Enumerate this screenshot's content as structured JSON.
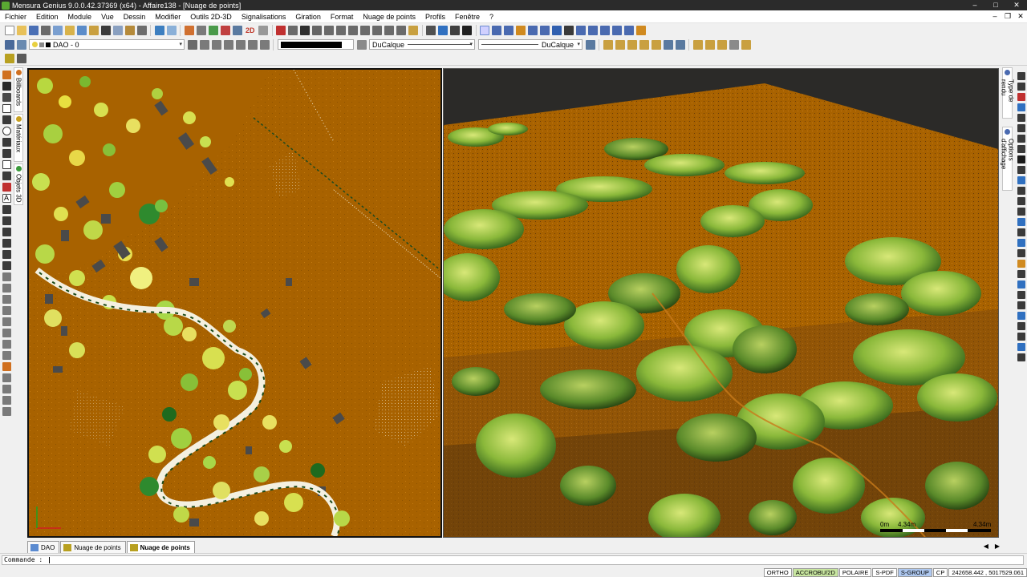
{
  "window": {
    "title": "Mensura Genius 9.0.0.42.37369 (x64) - Affaire138 - [Nuage de points]",
    "minimize": "–",
    "maximize": "□",
    "close": "✕"
  },
  "menu": {
    "items": [
      "Fichier",
      "Edition",
      "Module",
      "Vue",
      "Dessin",
      "Modifier",
      "Outils 2D-3D",
      "Signalisations",
      "Giration",
      "Format",
      "Nuage de points",
      "Profils",
      "Fenêtre",
      "?"
    ],
    "mdi_minimize": "–",
    "mdi_restore": "❐",
    "mdi_close": "✕"
  },
  "toolbar": {
    "mode_2d": "2D",
    "layer_combo": "DAO - 0",
    "linetype_combo": "DuCalque",
    "lineweight_combo": "DuCalque",
    "color_value": "#000000"
  },
  "left_tabs": [
    "Billboards",
    "Matériaux",
    "Objets 3D"
  ],
  "right_tabs": [
    "Type de rendu",
    "Options d'affichage"
  ],
  "views": {
    "ground_color": "#a86200",
    "sky_color": "#2b2a28",
    "scale_start": "0m",
    "scale_mid": "4.34m",
    "scale_end": "4.34m"
  },
  "tabs": [
    {
      "label": "DAO",
      "active": false
    },
    {
      "label": "Nuage de points",
      "active": false
    },
    {
      "label": "Nuage de points",
      "active": true
    }
  ],
  "tab_scroll_left": "◀",
  "tab_scroll_right": "▶",
  "command": {
    "prompt": "Commande :"
  },
  "status": {
    "ortho": "ORTHO",
    "accrobu": "ACCROBU/2D",
    "polaire": "POLAIRE",
    "spdf": "S-PDF",
    "sgroup": "S-GROUP",
    "cp": "CP",
    "coordinates": "242658.442 , 5017529.061"
  }
}
